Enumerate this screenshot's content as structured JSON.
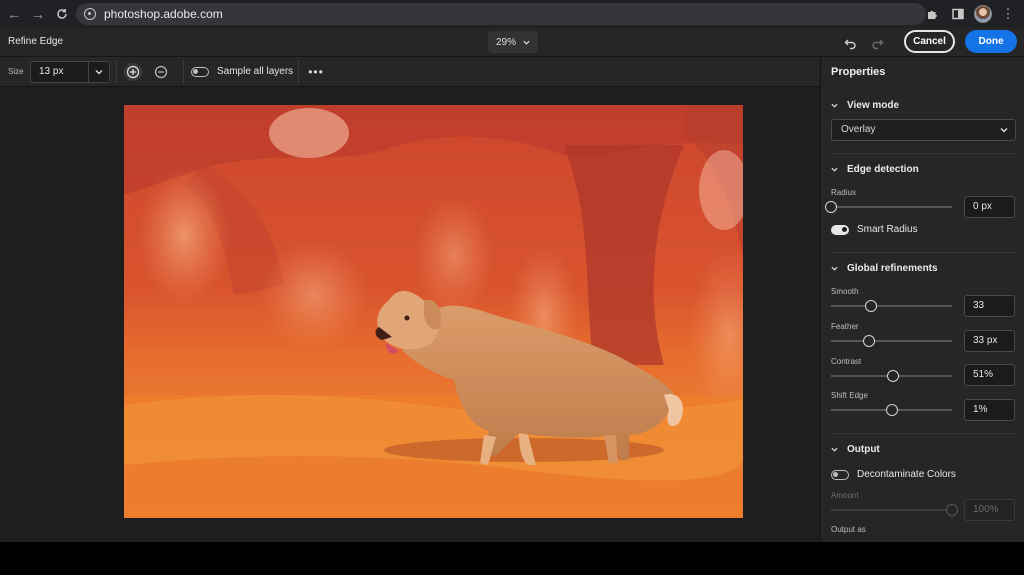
{
  "browser": {
    "url": "photoshop.adobe.com"
  },
  "header": {
    "title": "Refine Edge",
    "zoom": "29%",
    "cancel_label": "Cancel",
    "done_label": "Done"
  },
  "toolbar": {
    "size_label": "Size",
    "size_value": "13 px",
    "sample_all_layers_label": "Sample all layers",
    "sample_all_layers_on": false
  },
  "panel": {
    "title": "Properties",
    "view_mode": {
      "heading": "View mode",
      "selected": "Overlay"
    },
    "edge_detection": {
      "heading": "Edge detection",
      "radius_label": "Radius",
      "radius_value": "0 px",
      "radius_level": 0,
      "smart_radius_label": "Smart Radius",
      "smart_radius_on": true
    },
    "global_refinements": {
      "heading": "Global refinements",
      "smooth_label": "Smooth",
      "smooth_value": "33",
      "smooth_level": 0.33,
      "feather_label": "Feather",
      "feather_value": "33 px",
      "feather_level": 0.31,
      "contrast_label": "Contrast",
      "contrast_value": "51%",
      "contrast_level": 0.51,
      "shift_edge_label": "Shift Edge",
      "shift_edge_value": "1%",
      "shift_edge_level": 0.505
    },
    "output": {
      "heading": "Output",
      "decontaminate_label": "Decontaminate Colors",
      "decontaminate_on": false,
      "amount_label": "Amount",
      "amount_value": "100%",
      "amount_level": 1.0,
      "output_as_label": "Output as"
    }
  },
  "colors": {
    "accent": "#1473e6",
    "overlay_tint": "#e8472a"
  }
}
